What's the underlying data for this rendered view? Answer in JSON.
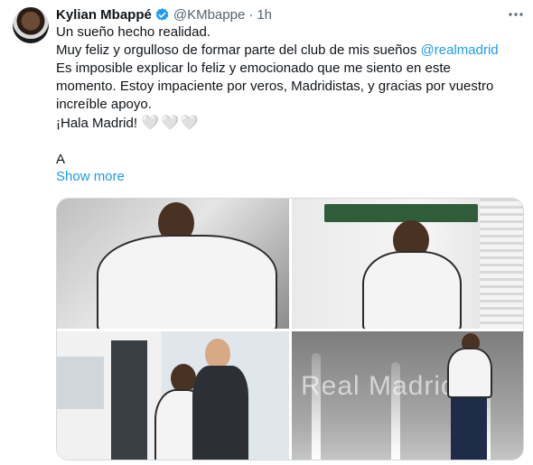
{
  "author": {
    "name": "Kylian Mbappé",
    "handle": "@KMbappe",
    "separator": "·",
    "time": "1h",
    "verified_color": "#1d9bf0"
  },
  "tweet": {
    "line1": "Un sueño hecho realidad.",
    "line2_text": "Muy feliz y orgulloso de formar parte del club de mis sueños ",
    "line2_mention": "@realmadrid",
    "line3": "Es imposible explicar lo feliz y emocionado que me siento en este",
    "line4": "momento. Estoy impaciente por veros, Madridistas, y gracias por vuestro",
    "line5": "increíble apoyo.",
    "line6": "¡Hala Madrid!",
    "hearts": "🤍🤍🤍",
    "line7": "A",
    "show_more": "Show more"
  },
  "media": {
    "photo4_watermark": "Real Madrid"
  },
  "colors": {
    "link": "#1d9bf0",
    "text": "#0f1419",
    "secondary": "#536471"
  }
}
